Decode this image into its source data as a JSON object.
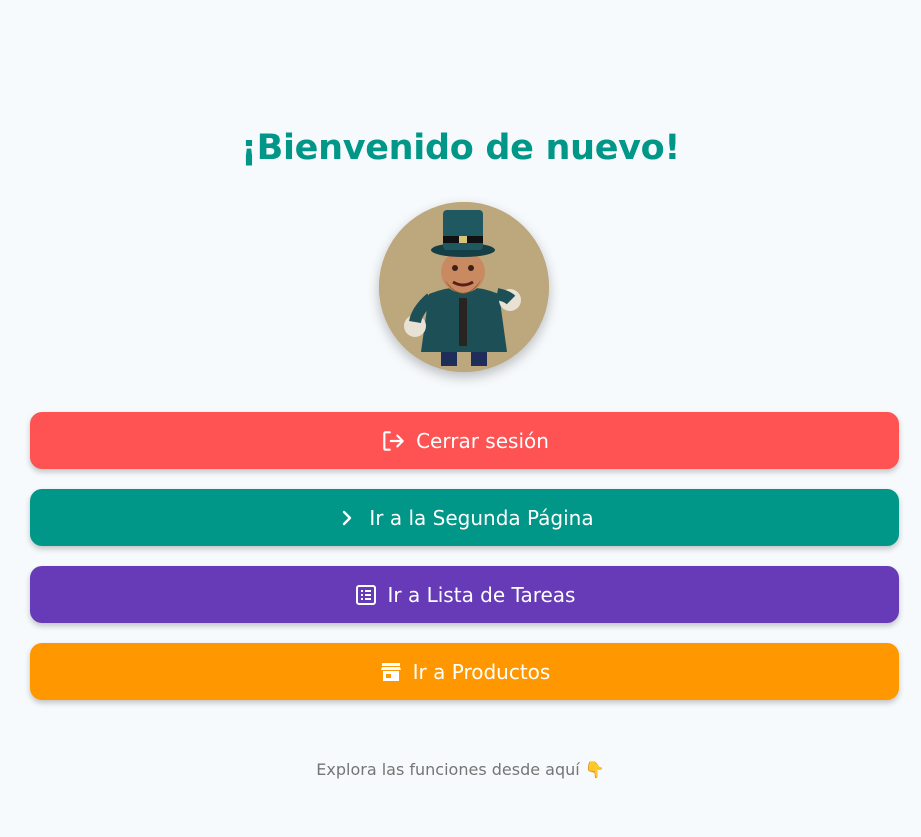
{
  "home": {
    "title": "¡Bienvenido de nuevo!",
    "avatar_icon": "leprechaun-avatar",
    "footer_text": "Explora las funciones desde aquí 👇"
  },
  "buttons": {
    "logout": {
      "label": "Cerrar sesión",
      "icon": "logout-icon",
      "color": "#ff5252"
    },
    "second_page": {
      "label": "Ir a la Segunda Página",
      "icon": "chevron-right-icon",
      "color": "#009688"
    },
    "task_list": {
      "label": "Ir a Lista de Tareas",
      "icon": "list-icon",
      "color": "#673ab7"
    },
    "products": {
      "label": "Ir a Productos",
      "icon": "store-icon",
      "color": "#ff9800"
    }
  },
  "theme": {
    "background": "#f7fafc",
    "title_color": "#009688",
    "footer_color": "#757575"
  }
}
